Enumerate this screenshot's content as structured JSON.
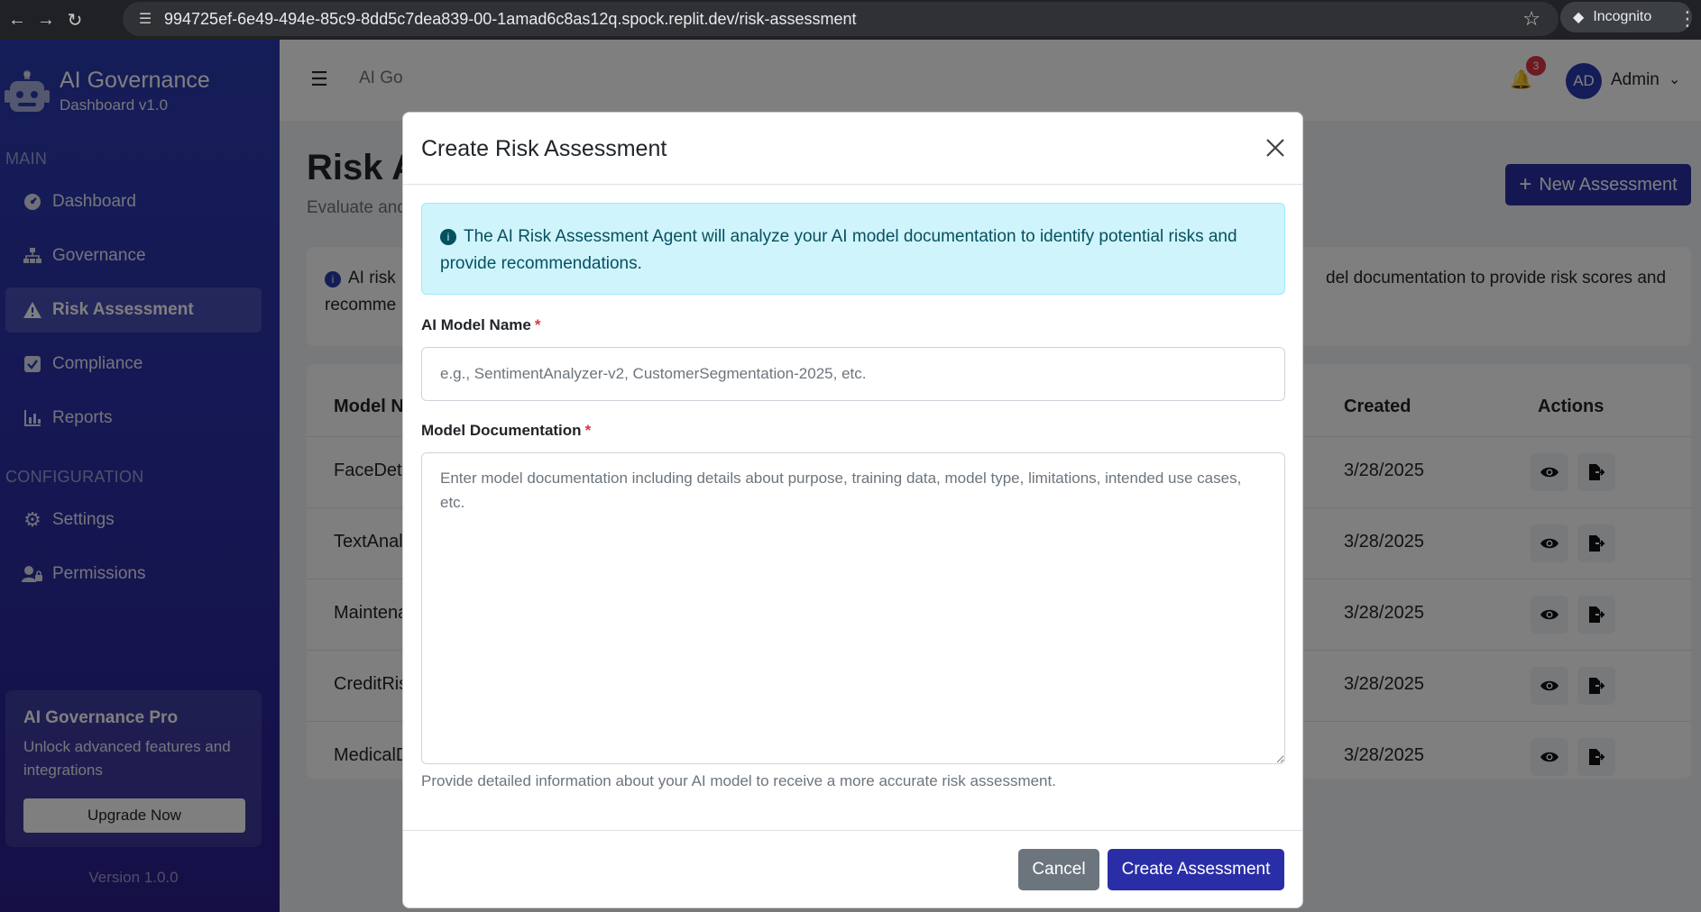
{
  "browser": {
    "url": "994725ef-6e49-494e-85c9-8dd5c7dea839-00-1amad6c8as12q.spock.replit.dev/risk-assessment",
    "incognito_label": "Incognito"
  },
  "sidebar": {
    "brand_title": "AI Governance",
    "brand_subtitle": "Dashboard v1.0",
    "section_main": "MAIN",
    "section_config": "CONFIGURATION",
    "items": [
      {
        "label": "Dashboard",
        "icon": "dashboard-icon"
      },
      {
        "label": "Governance",
        "icon": "sitemap-icon"
      },
      {
        "label": "Risk Assessment",
        "icon": "warning-icon",
        "active": true
      },
      {
        "label": "Compliance",
        "icon": "check-square-icon"
      },
      {
        "label": "Reports",
        "icon": "chart-icon"
      },
      {
        "label": "Settings",
        "icon": "gear-icon"
      },
      {
        "label": "Permissions",
        "icon": "user-lock-icon"
      }
    ],
    "pro": {
      "title": "AI Governance Pro",
      "desc": "Unlock advanced features and integrations",
      "button": "Upgrade Now"
    },
    "version": "Version 1.0.0"
  },
  "topbar": {
    "breadcrumb": "AI Go",
    "notification_count": "3",
    "avatar_initials": "AD",
    "username": "Admin"
  },
  "page": {
    "title": "Risk A",
    "subtitle": "Evaluate and",
    "new_button": "New Assessment",
    "info_text": "AI risk",
    "info_text_right": "del documentation to provide risk scores and",
    "info_text_line2": "recomme"
  },
  "table": {
    "headers": {
      "model": "Model Na",
      "created": "Created",
      "actions": "Actions"
    },
    "rows": [
      {
        "model": "FaceDetec",
        "created": "3/28/2025"
      },
      {
        "model": "TextAnaly",
        "created": "3/28/2025"
      },
      {
        "model": "Maintenar",
        "created": "3/28/2025"
      },
      {
        "model": "CreditRisk",
        "created": "3/28/2025"
      },
      {
        "model": "MedicalDi",
        "created": "3/28/2025"
      }
    ]
  },
  "modal": {
    "title": "Create Risk Assessment",
    "alert": "The AI Risk Assessment Agent will analyze your AI model documentation to identify potential risks and provide recommendations.",
    "name_label": "AI Model Name",
    "name_placeholder": "e.g., SentimentAnalyzer-v2, CustomerSegmentation-2025, etc.",
    "doc_label": "Model Documentation",
    "doc_placeholder": "Enter model documentation including details about purpose, training data, model type, limitations, intended use cases, etc.",
    "help": "Provide detailed information about your AI model to receive a more accurate risk assessment.",
    "required_mark": "*",
    "cancel": "Cancel",
    "create": "Create Assessment"
  },
  "colors": {
    "primary": "#2a2ea6",
    "sidebar_top": "#2a3bb0",
    "alert_bg": "#cff4fc",
    "danger": "#dc3545",
    "secondary": "#6c757d"
  }
}
